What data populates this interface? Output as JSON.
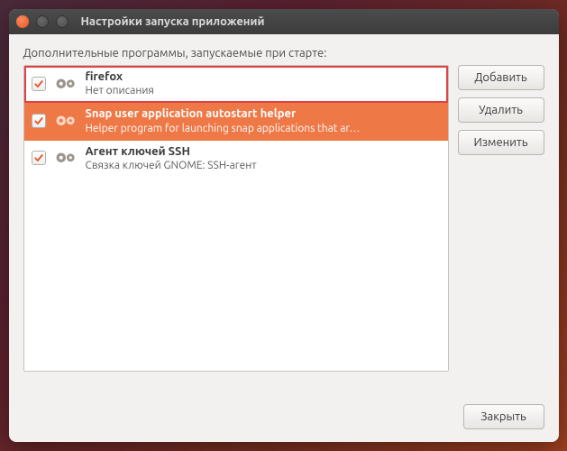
{
  "window": {
    "title": "Настройки запуска приложений"
  },
  "section_label": "Дополнительные программы, запускаемые при старте:",
  "buttons": {
    "add": "Добавить",
    "remove": "Удалить",
    "edit": "Изменить",
    "close": "Закрыть"
  },
  "items": [
    {
      "checked": true,
      "name": "firefox",
      "description": "Нет описания",
      "selected": false,
      "highlighted": true
    },
    {
      "checked": true,
      "name": "Snap user application autostart helper",
      "description": "Helper program for launching snap applications that ar…",
      "selected": true,
      "highlighted": false
    },
    {
      "checked": true,
      "name": "Агент ключей SSH",
      "description": "Связка ключей GNOME: SSH-агент",
      "selected": false,
      "highlighted": false
    }
  ]
}
